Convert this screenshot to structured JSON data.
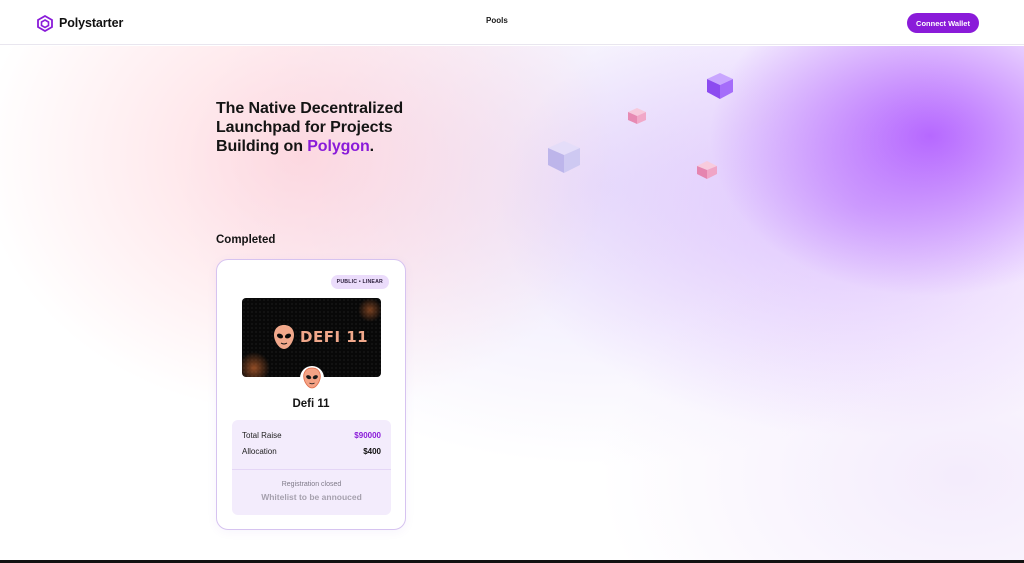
{
  "header": {
    "brand_name": "Polystarter",
    "nav": {
      "pools_label": "Pools"
    },
    "connect_wallet_label": "Connect Wallet"
  },
  "hero": {
    "title_main": "The Native Decentralized Launchpad for Projects Building on ",
    "title_accent": "Polygon",
    "title_end": "."
  },
  "section": {
    "completed_title": "Completed"
  },
  "pool": {
    "badge": "PUBLIC • LINEAR",
    "banner_text": "DEFI 11",
    "name": "Defi 11",
    "total_raise_label": "Total Raise",
    "total_raise_value": "$90000",
    "allocation_label": "Allocation",
    "allocation_value": "$400",
    "status": "Registration closed",
    "note": "Whitelist to be annouced"
  },
  "colors": {
    "accent": "#8a1bd9",
    "badge_bg": "#ebdcfb",
    "info_bg": "#f3ecfc",
    "card_border": "#d6c3f0",
    "banner_text": "#f1a88b"
  },
  "icons": {
    "brand_logo": "hexagon-logo-icon",
    "cube": "cube-icon",
    "mascot": "alien-mascot-icon"
  }
}
